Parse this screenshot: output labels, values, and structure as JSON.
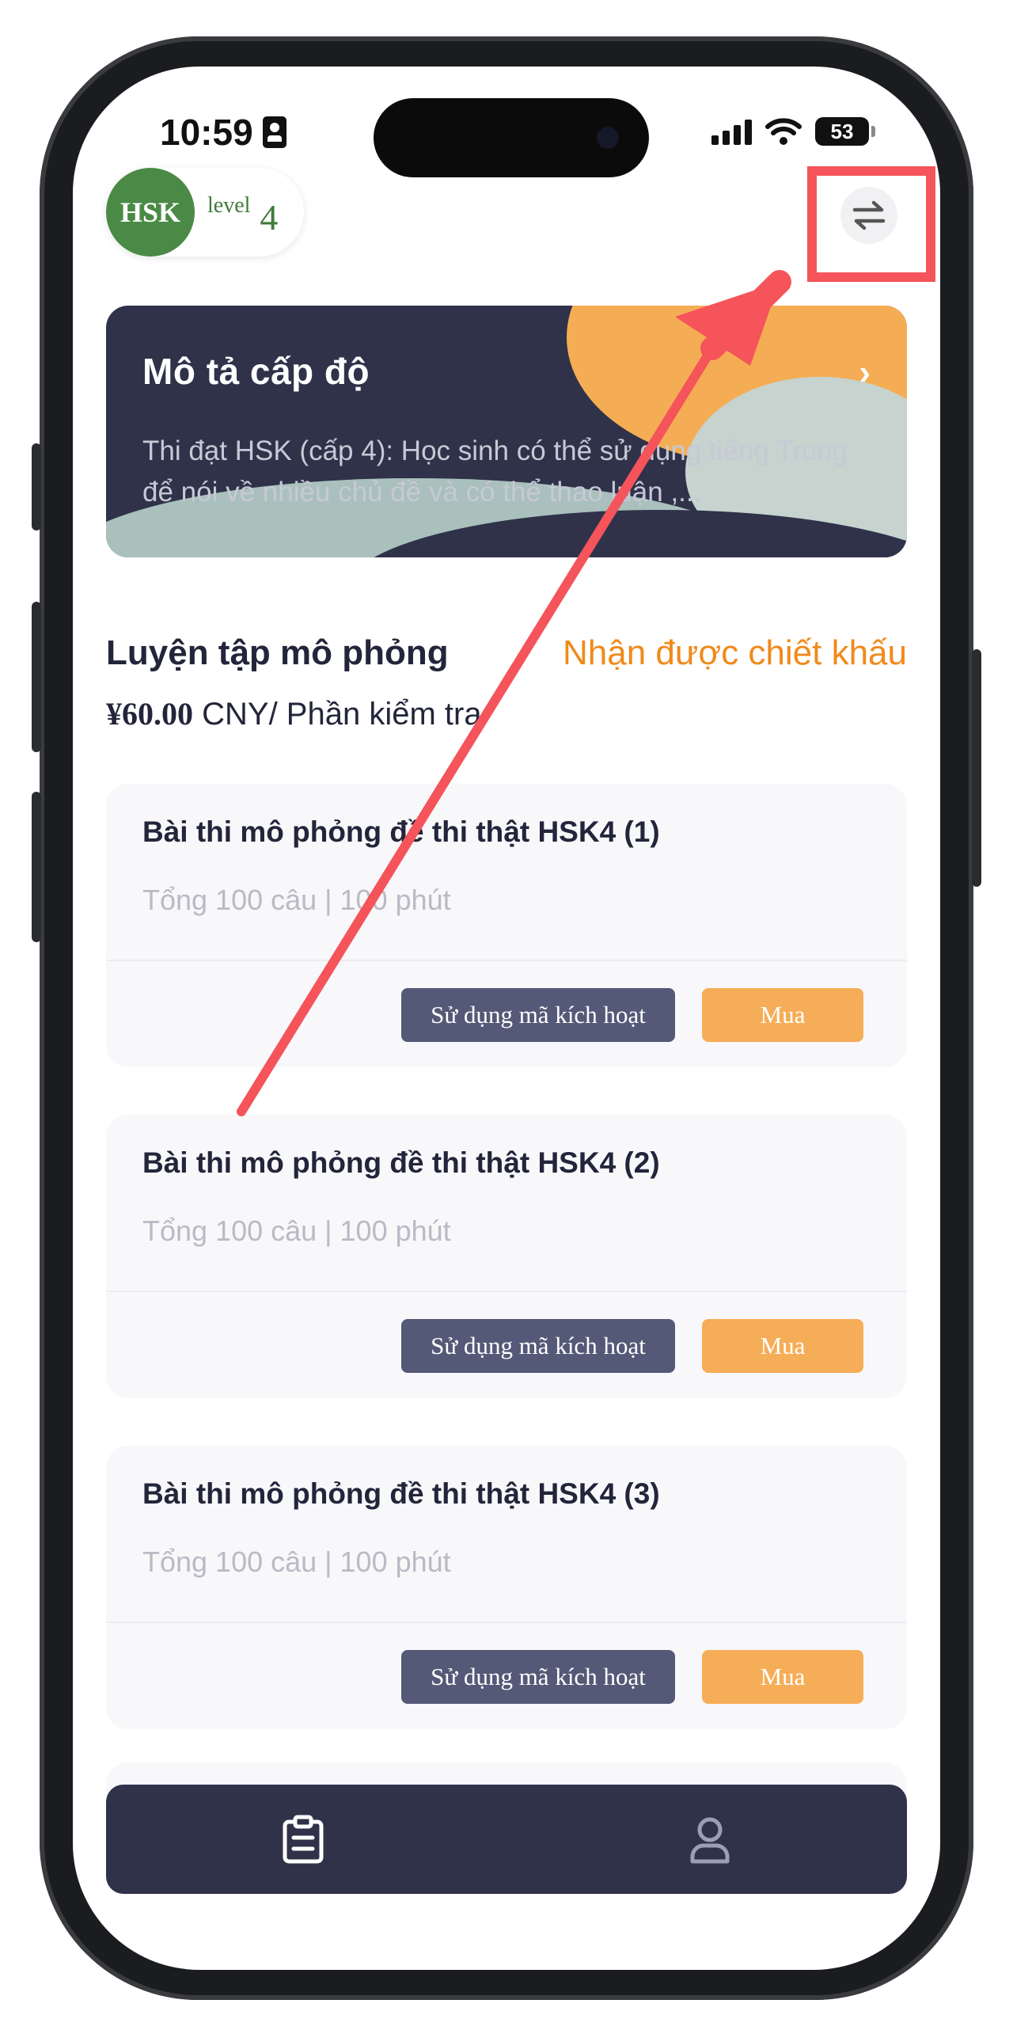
{
  "status_bar": {
    "time": "10:59",
    "battery": "53"
  },
  "header": {
    "logo_text": "HSK",
    "level_label": "level",
    "level_number": "4"
  },
  "banner": {
    "title": "Mô tả cấp độ",
    "description": "Thi đạt HSK (cấp 4): Học sinh có thể sử dụng tiếng Trung để  nói về nhiều chủ đề và có thể thao luận ,..."
  },
  "section": {
    "title": "Luyện tập mô phỏng",
    "discount_link": "Nhận được chiết khấu",
    "price_amount": "¥60.00",
    "price_unit": " CNY/ Phần kiểm tra"
  },
  "tests": [
    {
      "title": "Bài thi mô phỏng đề thi thật HSK4 (1)",
      "meta": "Tổng 100 câu | 100 phút",
      "activate_label": "Sử dụng mã kích hoạt",
      "buy_label": "Mua"
    },
    {
      "title": "Bài thi mô phỏng đề thi thật HSK4 (2)",
      "meta": "Tổng 100 câu | 100 phút",
      "activate_label": "Sử dụng mã kích hoạt",
      "buy_label": "Mua"
    },
    {
      "title": "Bài thi mô phỏng đề thi thật HSK4 (3)",
      "meta": "Tổng 100 câu | 100 phút",
      "activate_label": "Sử dụng mã kích hoạt",
      "buy_label": "Mua"
    }
  ],
  "icons": {
    "swap": "swap-arrows-icon",
    "banner_chevron": "chevron-right-icon",
    "tab_tests": "clipboard-list-icon",
    "tab_profile": "user-icon"
  },
  "colors": {
    "brand_green": "#4a8a46",
    "navy": "#2f3249",
    "orange_accent": "#f6ad57",
    "discount_orange": "#f08a1c",
    "annotation_red": "#f4545a"
  }
}
